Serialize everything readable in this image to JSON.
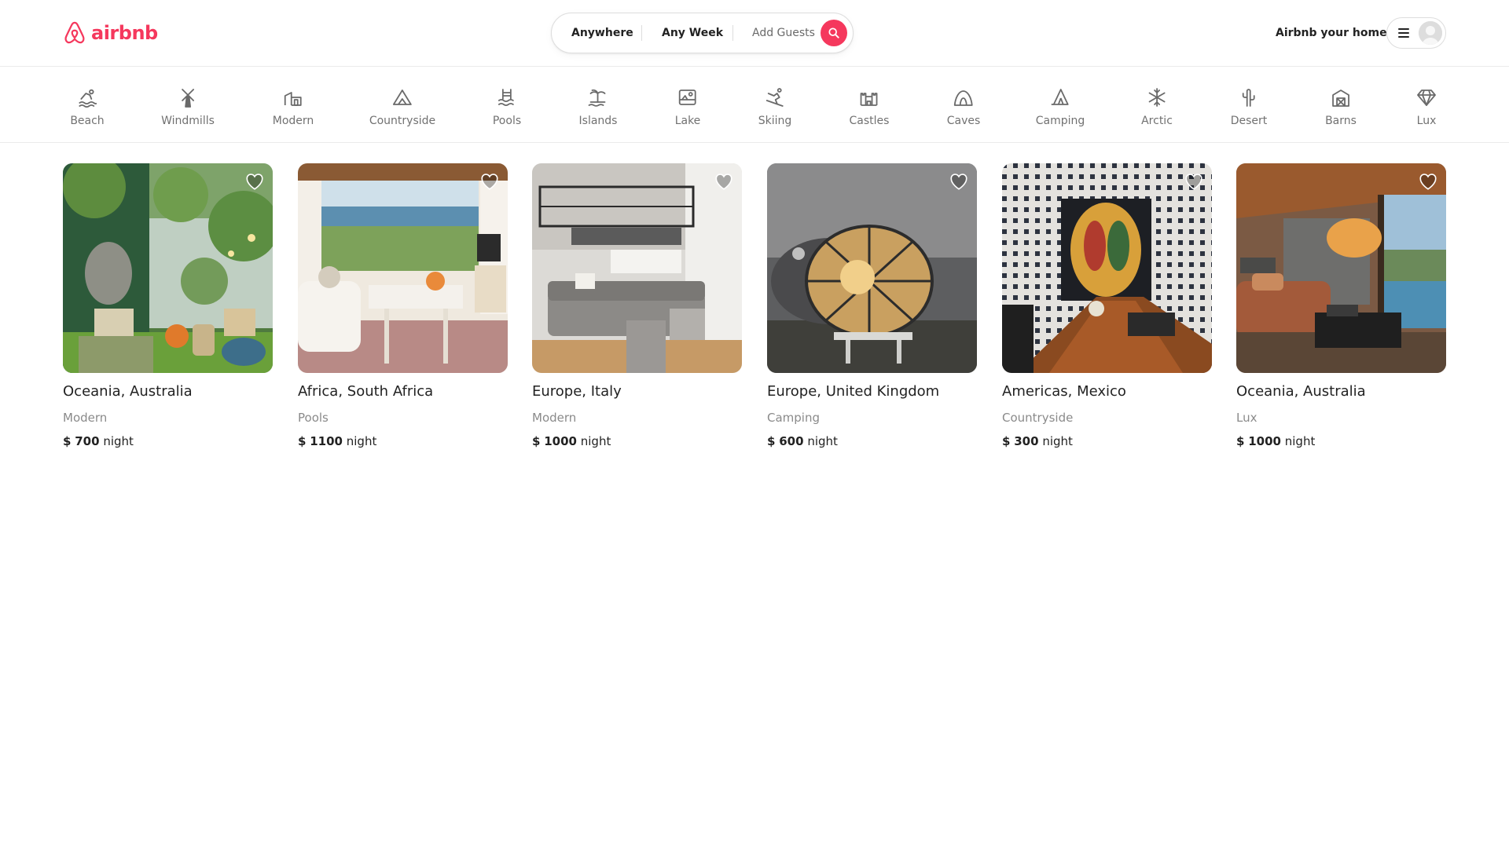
{
  "brand": {
    "name": "airbnb",
    "color": "#F5385D"
  },
  "search": {
    "where": "Anywhere",
    "when": "Any Week",
    "guests": "Add Guests"
  },
  "user_nav": {
    "host_link": "Airbnb your home"
  },
  "categories": [
    {
      "label": "Beach",
      "icon": "beach-icon"
    },
    {
      "label": "Windmills",
      "icon": "windmill-icon"
    },
    {
      "label": "Modern",
      "icon": "modern-house-icon"
    },
    {
      "label": "Countryside",
      "icon": "mountain-icon"
    },
    {
      "label": "Pools",
      "icon": "pool-icon"
    },
    {
      "label": "Islands",
      "icon": "island-icon"
    },
    {
      "label": "Lake",
      "icon": "lake-icon"
    },
    {
      "label": "Skiing",
      "icon": "skiing-icon"
    },
    {
      "label": "Castles",
      "icon": "castle-icon"
    },
    {
      "label": "Caves",
      "icon": "cave-icon"
    },
    {
      "label": "Camping",
      "icon": "tent-icon"
    },
    {
      "label": "Arctic",
      "icon": "snowflake-icon"
    },
    {
      "label": "Desert",
      "icon": "cactus-icon"
    },
    {
      "label": "Barns",
      "icon": "barn-icon"
    },
    {
      "label": "Lux",
      "icon": "diamond-icon"
    }
  ],
  "listings": [
    {
      "location": "Oceania, Australia",
      "category": "Modern",
      "currency": "$",
      "price": "700",
      "unit": "night"
    },
    {
      "location": "Africa, South Africa",
      "category": "Pools",
      "currency": "$",
      "price": "1100",
      "unit": "night"
    },
    {
      "location": "Europe, Italy",
      "category": "Modern",
      "currency": "$",
      "price": "1000",
      "unit": "night"
    },
    {
      "location": "Europe, United Kingdom",
      "category": "Camping",
      "currency": "$",
      "price": "600",
      "unit": "night"
    },
    {
      "location": "Americas, Mexico",
      "category": "Countryside",
      "currency": "$",
      "price": "300",
      "unit": "night"
    },
    {
      "location": "Oceania, Australia",
      "category": "Lux",
      "currency": "$",
      "price": "1000",
      "unit": "night"
    }
  ]
}
